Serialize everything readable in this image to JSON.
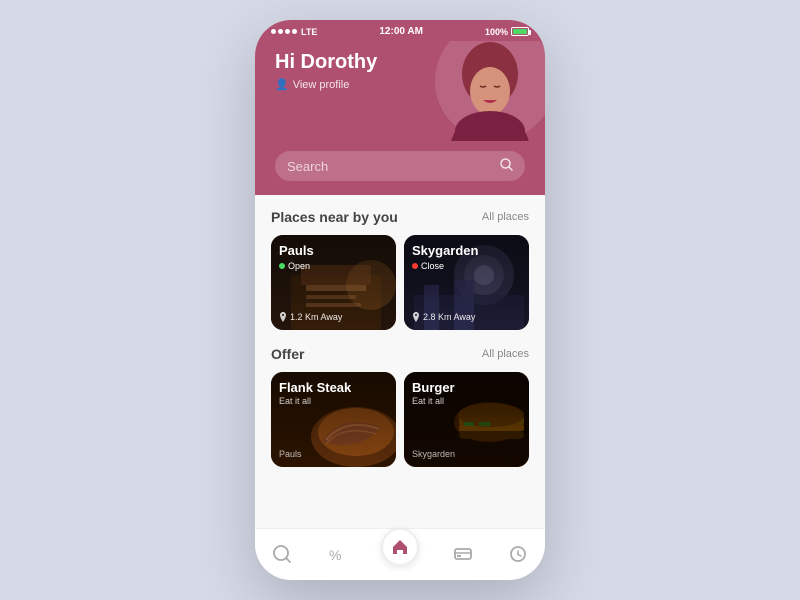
{
  "status_bar": {
    "signal": "●●●●",
    "network": "LTE",
    "time": "12:00 AM",
    "battery": "100%"
  },
  "header": {
    "greeting": "Hi Dorothy",
    "view_profile_label": "View profile"
  },
  "search": {
    "placeholder": "Search"
  },
  "nearby": {
    "section_title": "Places near by you",
    "all_label": "All places",
    "places": [
      {
        "name": "Pauls",
        "status": "Open",
        "status_type": "open",
        "distance": "1.2 Km Away"
      },
      {
        "name": "Skygarden",
        "status": "Close",
        "status_type": "closed",
        "distance": "2.8 Km Away"
      }
    ]
  },
  "offers": {
    "section_title": "Offer",
    "all_label": "All places",
    "items": [
      {
        "name": "Flank Steak",
        "subtitle": "Eat it all",
        "restaurant": "Pauls"
      },
      {
        "name": "Burger",
        "subtitle": "Eat it all",
        "restaurant": "Skygarden"
      }
    ]
  },
  "nav": {
    "items": [
      "search",
      "offers",
      "home",
      "payment",
      "history"
    ]
  },
  "colors": {
    "primary": "#b05070",
    "accent": "#b05070"
  }
}
